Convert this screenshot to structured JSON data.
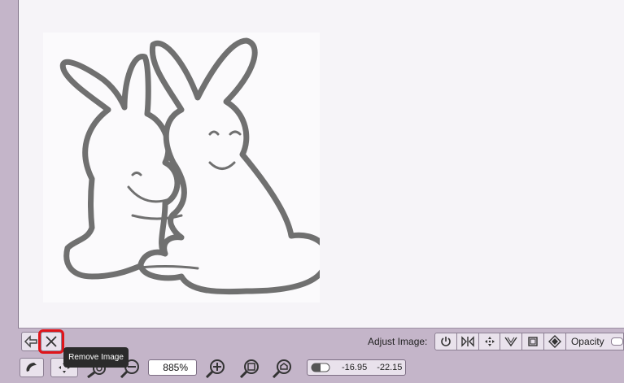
{
  "canvas": {
    "image": "bunnies-hugging-illustration"
  },
  "toolbar": {
    "back_icon": "arrow-left-icon",
    "remove_icon": "close-icon",
    "tooltip": "Remove Image",
    "adjust_label": "Adjust Image:",
    "adjust_buttons": [
      "power-icon",
      "flip-horizontal-icon",
      "move-icon",
      "perspective-icon",
      "crop-icon",
      "rotate-diamond-icon"
    ],
    "opacity_label": "Opacity"
  },
  "bottom": {
    "zoom_value": "885%",
    "coord_x": "-16.95",
    "coord_y": "-22.15"
  },
  "colors": {
    "highlight": "#e0141a",
    "chrome": "#c4b5c9",
    "tooltip_bg": "#2b2b2b"
  }
}
